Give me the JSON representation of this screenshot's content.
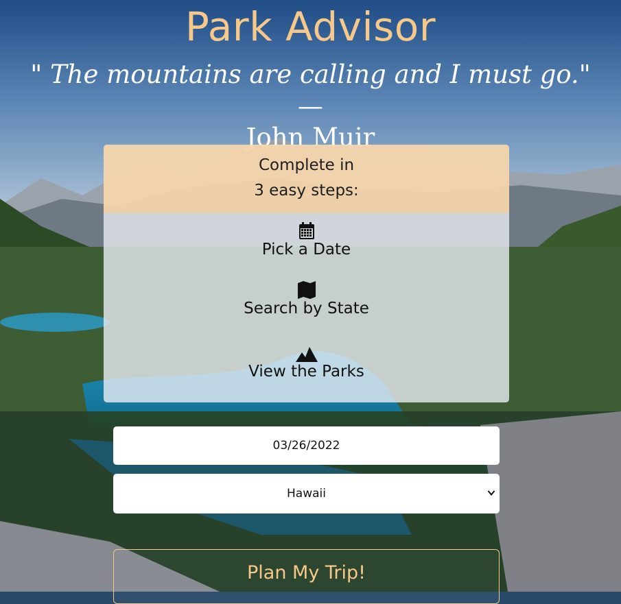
{
  "header": {
    "title": "Park Advisor",
    "quote": "\" The mountains are calling and I must go.\"",
    "quote_dash": " —",
    "quote_author": "John Muir"
  },
  "steps": {
    "intro_line1": "Complete in",
    "intro_line2": "3 easy steps:",
    "items": [
      {
        "label": "Pick a Date",
        "icon": "calendar-icon"
      },
      {
        "label": "Search by State",
        "icon": "map-icon"
      },
      {
        "label": "View the Parks",
        "icon": "mountains-icon"
      }
    ]
  },
  "form": {
    "date_value": "03/26/2022",
    "state_selected": "Hawaii",
    "submit_label": "Plan My Trip!"
  },
  "colors": {
    "accent": "#f6c98a",
    "header_panel": "#f8ce96",
    "card": "#e8ecf2"
  }
}
